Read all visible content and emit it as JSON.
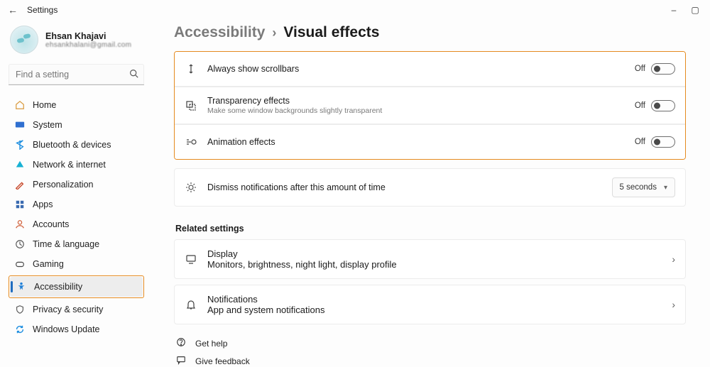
{
  "window": {
    "title": "Settings"
  },
  "user": {
    "name": "Ehsan Khajavi",
    "email": "ehsankhalani@gmail.com"
  },
  "search": {
    "placeholder": "Find a setting"
  },
  "nav": {
    "items": [
      {
        "label": "Home"
      },
      {
        "label": "System"
      },
      {
        "label": "Bluetooth & devices"
      },
      {
        "label": "Network & internet"
      },
      {
        "label": "Personalization"
      },
      {
        "label": "Apps"
      },
      {
        "label": "Accounts"
      },
      {
        "label": "Time & language"
      },
      {
        "label": "Gaming"
      },
      {
        "label": "Accessibility"
      },
      {
        "label": "Privacy & security"
      },
      {
        "label": "Windows Update"
      }
    ]
  },
  "breadcrumb": {
    "parent": "Accessibility",
    "current": "Visual effects"
  },
  "settings": {
    "scrollbars": {
      "title": "Always show scrollbars",
      "state": "Off"
    },
    "transparency": {
      "title": "Transparency effects",
      "sub": "Make some window backgrounds slightly transparent",
      "state": "Off"
    },
    "animation": {
      "title": "Animation effects",
      "state": "Off"
    },
    "dismiss": {
      "title": "Dismiss notifications after this amount of time",
      "value": "5 seconds"
    }
  },
  "related": {
    "heading": "Related settings",
    "display": {
      "title": "Display",
      "sub": "Monitors, brightness, night light, display profile"
    },
    "notifications": {
      "title": "Notifications",
      "sub": "App and system notifications"
    }
  },
  "footer": {
    "help": "Get help",
    "feedback": "Give feedback"
  }
}
